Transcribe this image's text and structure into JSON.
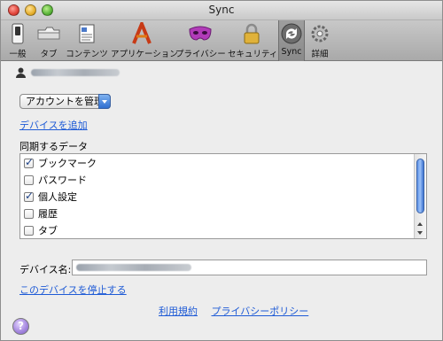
{
  "window": {
    "title": "Sync"
  },
  "toolbar": {
    "items": [
      {
        "label": "一般",
        "icon": "switch-icon"
      },
      {
        "label": "タブ",
        "icon": "tabs-icon"
      },
      {
        "label": "コンテンツ",
        "icon": "content-icon"
      },
      {
        "label": "アプリケーション",
        "icon": "applications-icon"
      },
      {
        "label": "プライバシー",
        "icon": "privacy-mask-icon"
      },
      {
        "label": "セキュリティ",
        "icon": "lock-icon"
      },
      {
        "label": "Sync",
        "icon": "sync-icon",
        "selected": true
      },
      {
        "label": "詳細",
        "icon": "gear-icon"
      }
    ]
  },
  "account": {
    "manage_button": "アカウントを管理",
    "add_device_link": "デバイスを追加"
  },
  "sync_data": {
    "label": "同期するデータ",
    "items": [
      {
        "label": "ブックマーク",
        "checked": true
      },
      {
        "label": "パスワード",
        "checked": false
      },
      {
        "label": "個人設定",
        "checked": true
      },
      {
        "label": "履歴",
        "checked": false
      },
      {
        "label": "タブ",
        "checked": false
      }
    ]
  },
  "device": {
    "name_label": "デバイス名:",
    "stop_link": "このデバイスを停止する"
  },
  "footer": {
    "terms_link": "利用規約",
    "privacy_link": "プライバシーポリシー"
  },
  "help": {
    "glyph": "?"
  },
  "colors": {
    "link": "#1f5bd6",
    "accent": "#2f6fd0"
  }
}
